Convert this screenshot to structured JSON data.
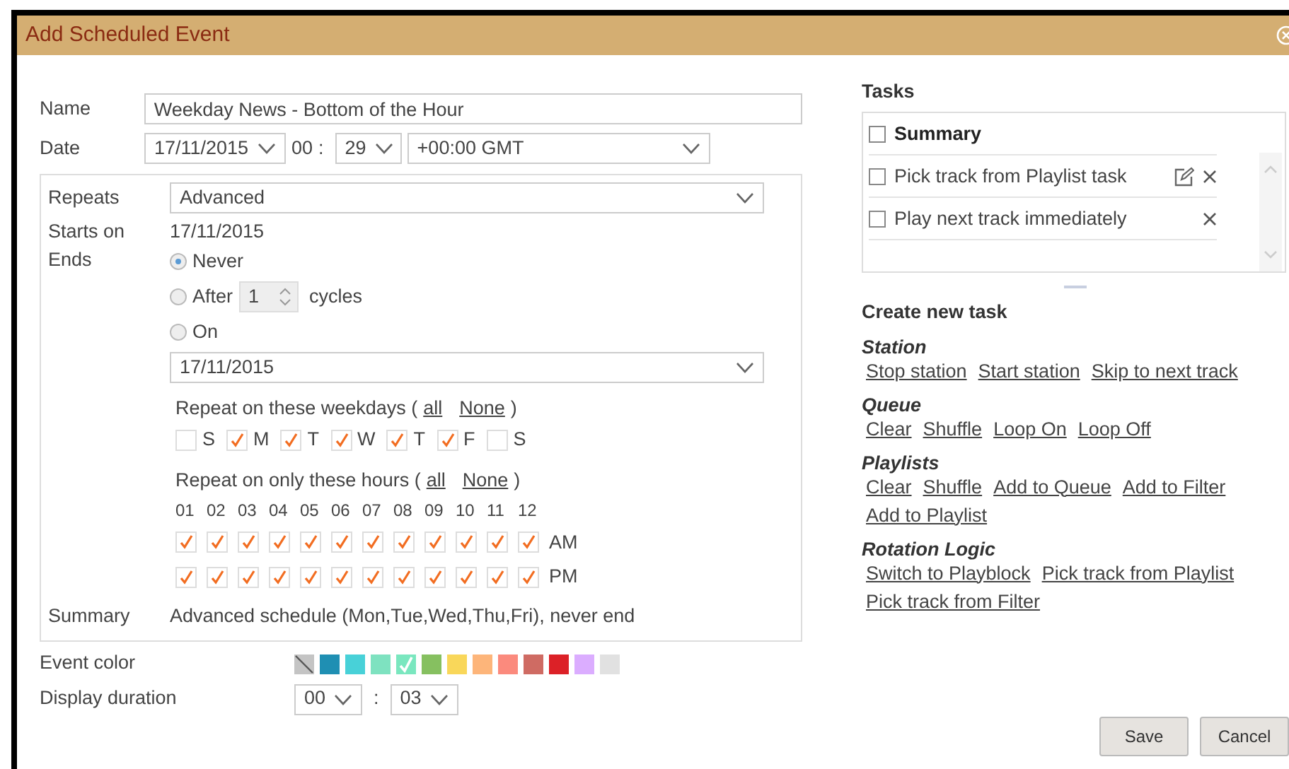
{
  "window": {
    "title": "Add Scheduled Event"
  },
  "form": {
    "name_label": "Name",
    "name_value": "Weekday News - Bottom of the Hour",
    "date_label": "Date",
    "date": "17/11/2015",
    "hour": "00",
    "hour_sep": ":",
    "minute": "29",
    "timezone": "+00:00 GMT"
  },
  "repeat": {
    "repeats_label": "Repeats",
    "repeats_value": "Advanced",
    "starts_label": "Starts on",
    "starts_value": "17/11/2015",
    "ends_label": "Ends",
    "ends_options": [
      {
        "kind": "plain",
        "label": "Never",
        "selected": true
      },
      {
        "kind": "cycles",
        "label": "After",
        "value": "1",
        "suffix": "cycles",
        "selected": false
      },
      {
        "kind": "plain",
        "label": "On",
        "selected": false
      }
    ],
    "end_date": "17/11/2015",
    "weekdays_title": "Repeat on these weekdays (",
    "weekdays_all": "all",
    "weekdays_none": "None",
    "weekdays_close": ")",
    "weekdays": [
      {
        "label": "S",
        "checked": false
      },
      {
        "label": "M",
        "checked": true
      },
      {
        "label": "T",
        "checked": true
      },
      {
        "label": "W",
        "checked": true
      },
      {
        "label": "T",
        "checked": true
      },
      {
        "label": "F",
        "checked": true
      },
      {
        "label": "S",
        "checked": false
      }
    ],
    "hours_title": "Repeat on only these hours (",
    "hours_all": "all",
    "hours_none": "None",
    "hours_close": ")",
    "hour_labels": [
      "01",
      "02",
      "03",
      "04",
      "05",
      "06",
      "07",
      "08",
      "09",
      "10",
      "11",
      "12"
    ],
    "hour_rows": [
      {
        "label": "AM",
        "checked": [
          true,
          true,
          true,
          true,
          true,
          true,
          true,
          true,
          true,
          true,
          true,
          true
        ]
      },
      {
        "label": "PM",
        "checked": [
          true,
          true,
          true,
          true,
          true,
          true,
          true,
          true,
          true,
          true,
          true,
          true
        ]
      }
    ],
    "summary_label": "Summary",
    "summary_value": "Advanced schedule (Mon,Tue,Wed,Thu,Fri), never end"
  },
  "event_color": {
    "label": "Event color",
    "swatches": [
      {
        "kind": "none",
        "color": "#c4c4c4",
        "selected": false
      },
      {
        "kind": "color",
        "color": "#1f8fb3",
        "selected": false
      },
      {
        "kind": "color",
        "color": "#48d1d8",
        "selected": false
      },
      {
        "kind": "color",
        "color": "#7ee2c0",
        "selected": false
      },
      {
        "kind": "color",
        "color": "#7ae7bf",
        "selected": true
      },
      {
        "kind": "color",
        "color": "#86c060",
        "selected": false
      },
      {
        "kind": "color",
        "color": "#f9d75a",
        "selected": false
      },
      {
        "kind": "color",
        "color": "#fdb57a",
        "selected": false
      },
      {
        "kind": "color",
        "color": "#fb8a7d",
        "selected": false
      },
      {
        "kind": "color",
        "color": "#cf6b63",
        "selected": false
      },
      {
        "kind": "color",
        "color": "#dc2127",
        "selected": false
      },
      {
        "kind": "color",
        "color": "#dbadff",
        "selected": false
      },
      {
        "kind": "color",
        "color": "#e1e1e1",
        "selected": false
      }
    ]
  },
  "display_duration": {
    "label": "Display duration",
    "hours": "00",
    "sep": ":",
    "minutes": "03"
  },
  "tasks": {
    "title": "Tasks",
    "header": {
      "label": "Summary",
      "checked": false
    },
    "items": [
      {
        "label": "Pick track from Playlist task",
        "checked": false,
        "editable": true
      },
      {
        "label": "Play next track immediately",
        "checked": false,
        "editable": false
      }
    ]
  },
  "create_task": {
    "title": "Create new task",
    "groups": [
      {
        "title": "Station",
        "links": [
          "Stop station",
          "Start station",
          "Skip to next track"
        ]
      },
      {
        "title": "Queue",
        "links": [
          "Clear",
          "Shuffle",
          "Loop On",
          "Loop Off"
        ]
      },
      {
        "title": "Playlists",
        "links": [
          "Clear",
          "Shuffle",
          "Add to Queue",
          "Add to Filter",
          "Add to Playlist"
        ]
      },
      {
        "title": "Rotation Logic",
        "links": [
          "Switch to Playblock",
          "Pick track from Playlist",
          "Pick track from Filter"
        ]
      }
    ]
  },
  "buttons": [
    "Save",
    "Cancel"
  ]
}
